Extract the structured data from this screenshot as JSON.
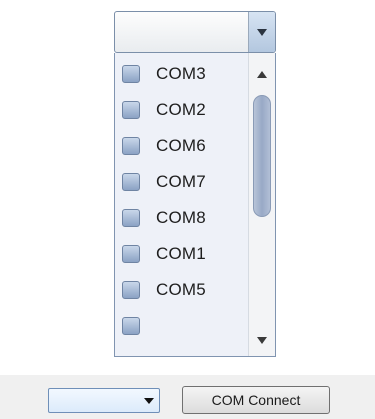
{
  "port_dropdown": {
    "selected_value": "",
    "options": [
      {
        "label": "COM3"
      },
      {
        "label": "COM2"
      },
      {
        "label": "COM6"
      },
      {
        "label": "COM7"
      },
      {
        "label": "COM8"
      },
      {
        "label": "COM1"
      },
      {
        "label": "COM5"
      },
      {
        "label": ""
      }
    ]
  },
  "toolbar": {
    "small_combo_value": "",
    "connect_button_label": "COM Connect"
  },
  "icons": {
    "dropdown_arrow": "chevron-down-icon",
    "scroll_up": "scroll-up-arrow-icon",
    "scroll_down": "scroll-down-arrow-icon"
  }
}
